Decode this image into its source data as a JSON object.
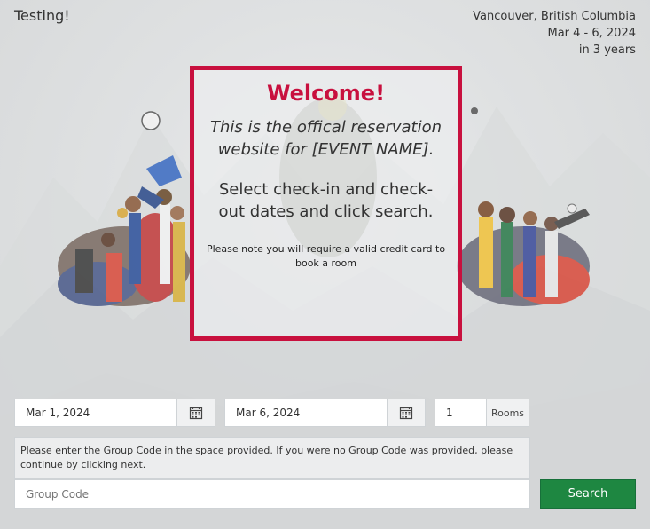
{
  "header": {
    "site_title": "Testing!",
    "event_location": "Vancouver, British Columbia",
    "event_dates": "Mar 4 - 6, 2024",
    "event_countdown": "in 3 years"
  },
  "welcome": {
    "title": "Welcome!",
    "intro": "This is the offical reservation website for [EVENT NAME].",
    "instructions": "Select check-in and check-out dates and click search.",
    "note": "Please note you will require a valid credit card to book a room"
  },
  "form": {
    "check_in_value": "Mar 1, 2024",
    "check_out_value": "Mar 6, 2024",
    "rooms_value": "1",
    "rooms_label": "Rooms",
    "group_code_note": "Please enter the Group Code in the space provided. If you were no Group Code was provided, please continue by clicking next.",
    "group_code_placeholder": "Group Code",
    "search_label": "Search"
  },
  "colors": {
    "accent_red": "#c8103e",
    "search_green": "#1e8741"
  },
  "icons": {
    "calendar": "calendar-icon"
  }
}
